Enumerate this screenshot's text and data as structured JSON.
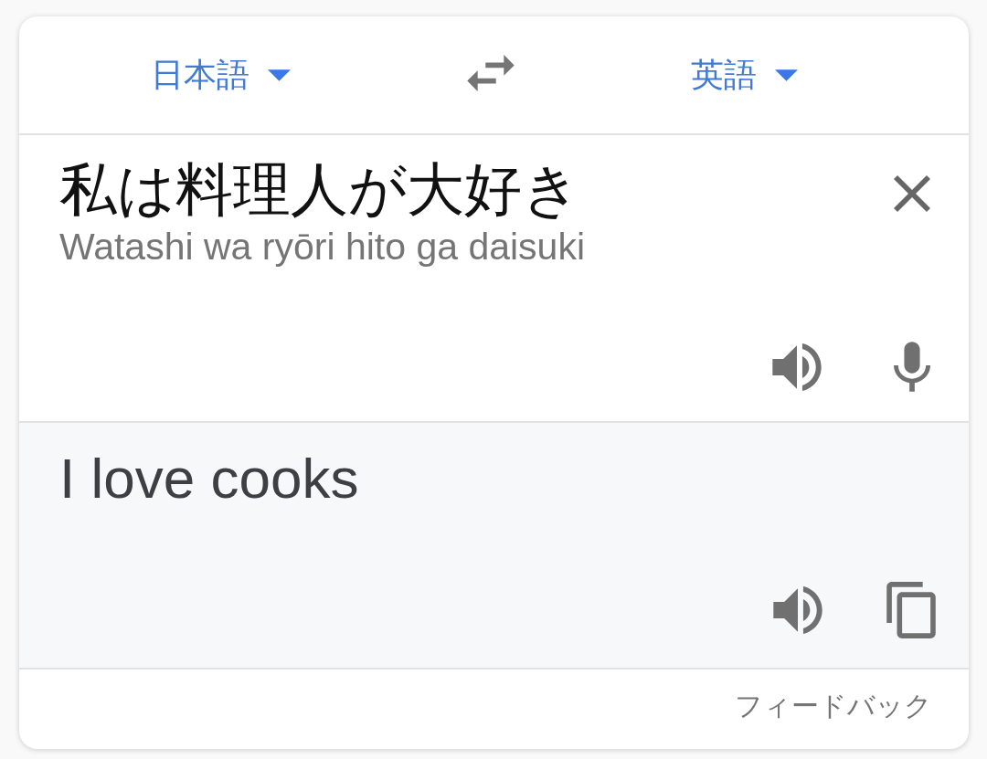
{
  "languages": {
    "source": {
      "label": "日本語"
    },
    "target": {
      "label": "英語"
    }
  },
  "source": {
    "text": "私は料理人が大好き",
    "romanization": "Watashi wa ryōri hito ga daisuki"
  },
  "translation": {
    "text": "I love cooks"
  },
  "footer": {
    "feedback": "フィードバック"
  }
}
